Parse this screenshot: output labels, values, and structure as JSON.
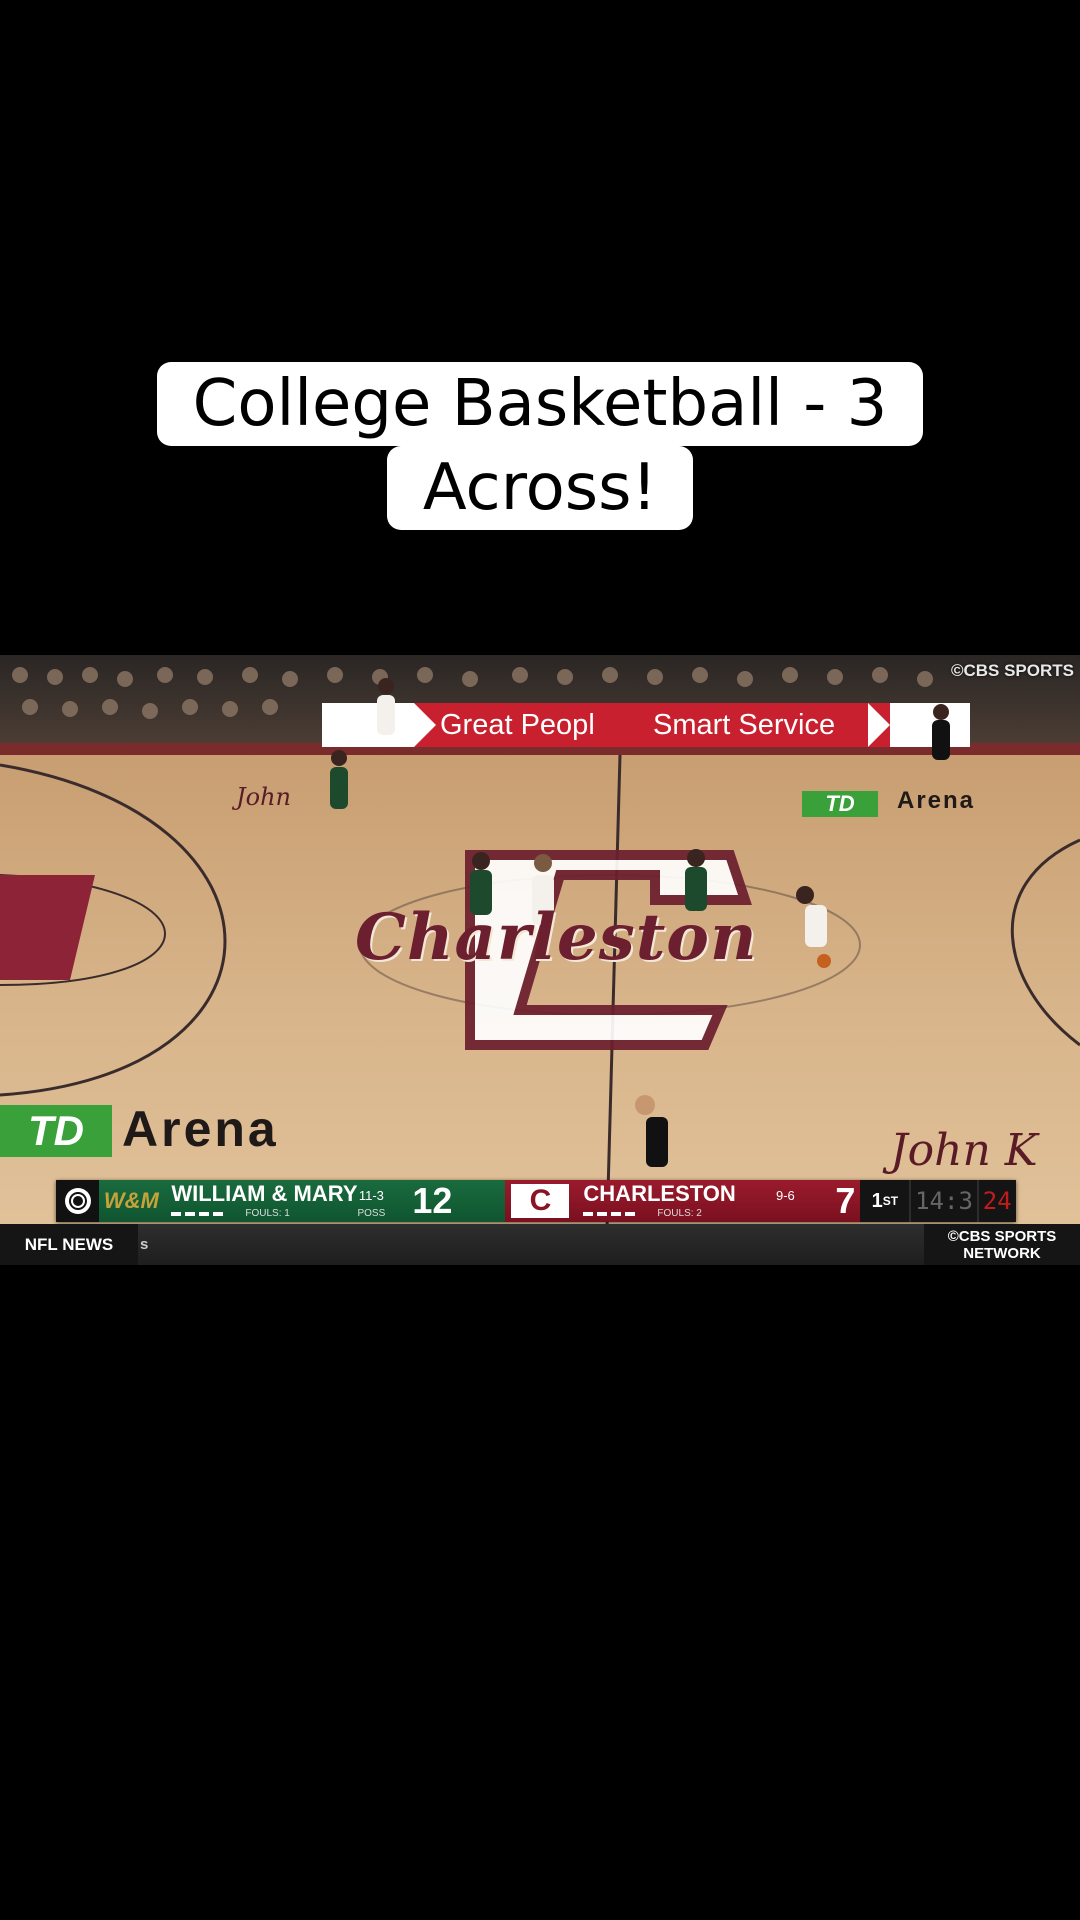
{
  "caption": {
    "line1": "College Basketball - 3",
    "line2": "Across!"
  },
  "video": {
    "watermark": "©CBS SPORTS",
    "adboard": {
      "text1": "Great Peopl",
      "text2": "Smart Service"
    },
    "floor": {
      "wordmark": "Charleston",
      "arena_left": "Arena",
      "arena_right": "Arena",
      "td_left": "TD",
      "td_right": "TD",
      "script_left": "John",
      "script_right": "John K"
    }
  },
  "scorebug": {
    "away": {
      "logo": "W&M",
      "name": "WILLIAM & MARY",
      "fouls": "FOULS: 1",
      "record": "11-3",
      "poss": "POSS",
      "score": "12",
      "color": "#1a6b3e"
    },
    "home": {
      "logo": "C",
      "name": "CHARLESTON",
      "fouls": "FOULS: 2",
      "record": "9-6",
      "score": "7",
      "color": "#9a1b2c"
    },
    "period": "1",
    "period_suffix": "ST",
    "clock": "14:3",
    "shot_clock": "24"
  },
  "ticker": {
    "label": "NFL NEWS",
    "text": "s",
    "network_line1": "©CBS SPORTS",
    "network_line2": "NETWORK"
  }
}
